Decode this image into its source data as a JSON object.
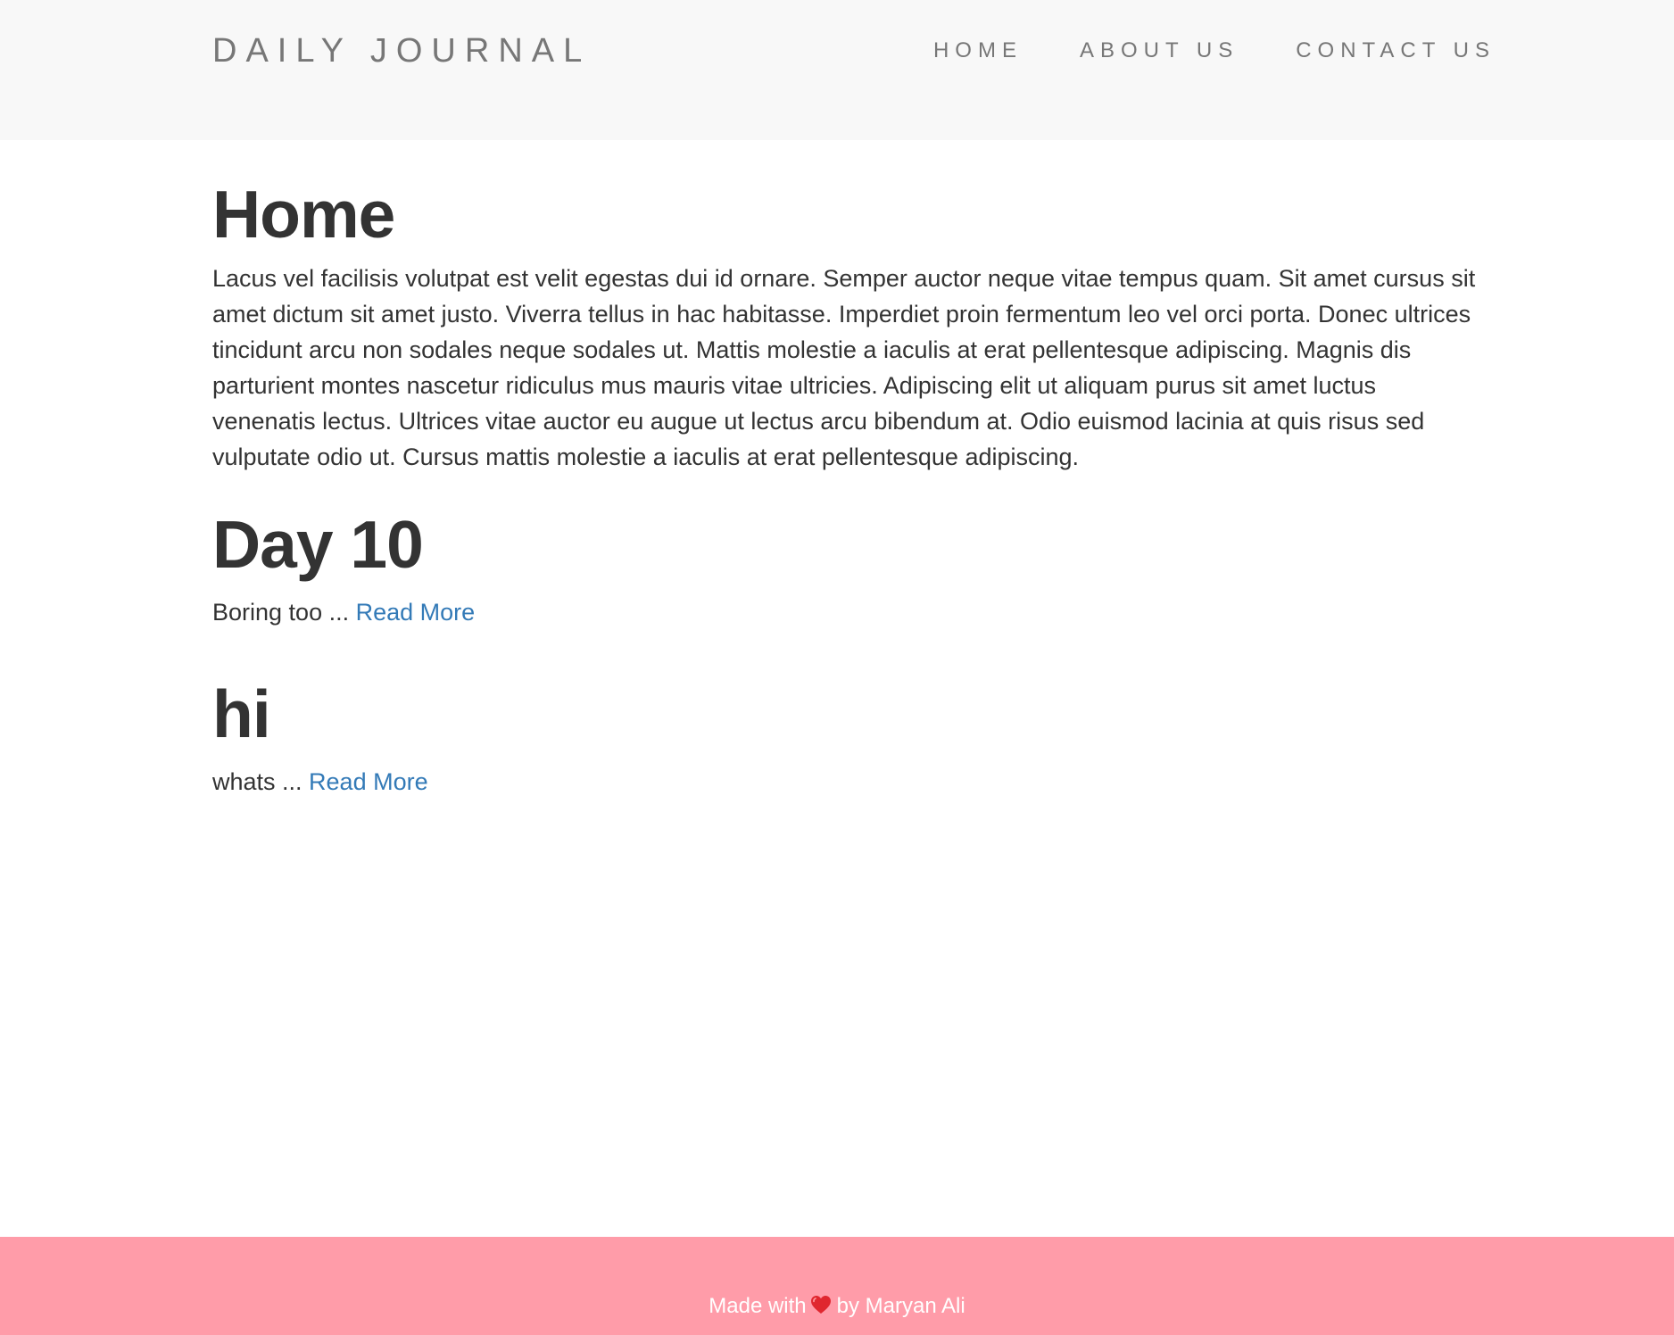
{
  "navbar": {
    "brand": "DAILY JOURNAL",
    "links": [
      "HOME",
      "ABOUT US",
      "CONTACT US"
    ]
  },
  "main": {
    "title": "Home",
    "intro": "Lacus vel facilisis volutpat est velit egestas dui id ornare. Semper auctor neque vitae tempus quam. Sit amet cursus sit amet dictum sit amet justo. Viverra tellus in hac habitasse. Imperdiet proin fermentum leo vel orci porta. Donec ultrices tincidunt arcu non sodales neque sodales ut. Mattis molestie a iaculis at erat pellentesque adipiscing. Magnis dis parturient montes nascetur ridiculus mus mauris vitae ultricies. Adipiscing elit ut aliquam purus sit amet luctus venenatis lectus. Ultrices vitae auctor eu augue ut lectus arcu bibendum at. Odio euismod lacinia at quis risus sed vulputate odio ut. Cursus mattis molestie a iaculis at erat pellentesque adipiscing.",
    "posts": [
      {
        "title": "Day 10",
        "excerpt": "Boring too ... ",
        "link": "Read More"
      },
      {
        "title": "hi",
        "excerpt": "whats ... ",
        "link": "Read More"
      }
    ]
  },
  "footer": {
    "prefix": "Made with",
    "icon": "heart-icon",
    "suffix": "by Maryan Ali"
  },
  "colors": {
    "navbar_bg": "#f8f8f8",
    "footer_bg": "#ff9ca9",
    "link": "#337ab7",
    "heart": "#e0272f"
  }
}
